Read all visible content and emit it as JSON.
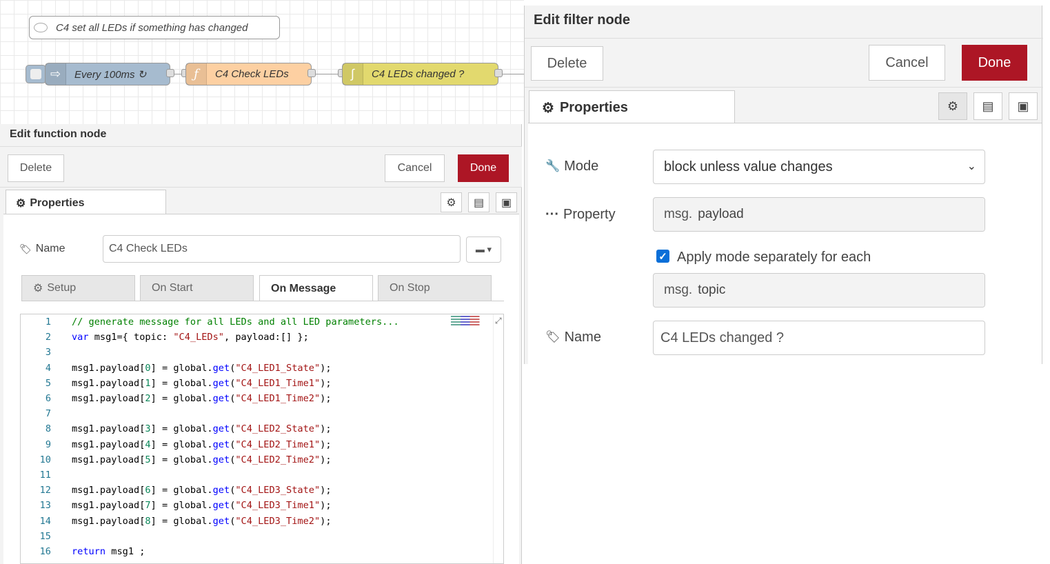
{
  "canvas": {
    "comment": "C4 set all LEDs if something has changed",
    "nodes": {
      "inject": "Every 100ms ↻",
      "function": "C4 Check LEDs",
      "filter": "C4 LEDs changed ?"
    },
    "colors": {
      "inject": "#a6bbcf",
      "function": "#fdd0a2",
      "filter": "#e2d96e"
    }
  },
  "function_editor": {
    "title": "Edit function node",
    "delete_label": "Delete",
    "cancel_label": "Cancel",
    "done_label": "Done",
    "properties_tab": "Properties",
    "name_label": "Name",
    "name_value": "C4 Check LEDs",
    "tabs": [
      "Setup",
      "On Start",
      "On Message",
      "On Stop"
    ],
    "active_tab": "On Message",
    "code_lines": [
      {
        "n": "1",
        "text": "// generate message for all LEDs and all LED parameters..."
      },
      {
        "n": "2",
        "text": "var msg1={ topic: \"C4_LEDs\", payload:[] };"
      },
      {
        "n": "3",
        "text": ""
      },
      {
        "n": "4",
        "text": "msg1.payload[0] = global.get(\"C4_LED1_State\");"
      },
      {
        "n": "5",
        "text": "msg1.payload[1] = global.get(\"C4_LED1_Time1\");"
      },
      {
        "n": "6",
        "text": "msg1.payload[2] = global.get(\"C4_LED1_Time2\");"
      },
      {
        "n": "7",
        "text": ""
      },
      {
        "n": "8",
        "text": "msg1.payload[3] = global.get(\"C4_LED2_State\");"
      },
      {
        "n": "9",
        "text": "msg1.payload[4] = global.get(\"C4_LED2_Time1\");"
      },
      {
        "n": "10",
        "text": "msg1.payload[5] = global.get(\"C4_LED2_Time2\");"
      },
      {
        "n": "11",
        "text": ""
      },
      {
        "n": "12",
        "text": "msg1.payload[6] = global.get(\"C4_LED3_State\");"
      },
      {
        "n": "13",
        "text": "msg1.payload[7] = global.get(\"C4_LED3_Time1\");"
      },
      {
        "n": "14",
        "text": "msg1.payload[8] = global.get(\"C4_LED3_Time2\");"
      },
      {
        "n": "15",
        "text": ""
      },
      {
        "n": "16",
        "text": "return msg1 ;"
      }
    ]
  },
  "filter_editor": {
    "title": "Edit filter node",
    "delete_label": "Delete",
    "cancel_label": "Cancel",
    "done_label": "Done",
    "properties_tab": "Properties",
    "mode_label": "Mode",
    "mode_value": "block unless value changes",
    "property_label": "Property",
    "property_prefix": "msg.",
    "property_value": "payload",
    "separate_label": "Apply mode separately for each",
    "separate_checked": true,
    "topic_prefix": "msg.",
    "topic_value": "topic",
    "name_label": "Name",
    "name_value": "C4 LEDs changed ?"
  },
  "accent_color": "#ad1625"
}
